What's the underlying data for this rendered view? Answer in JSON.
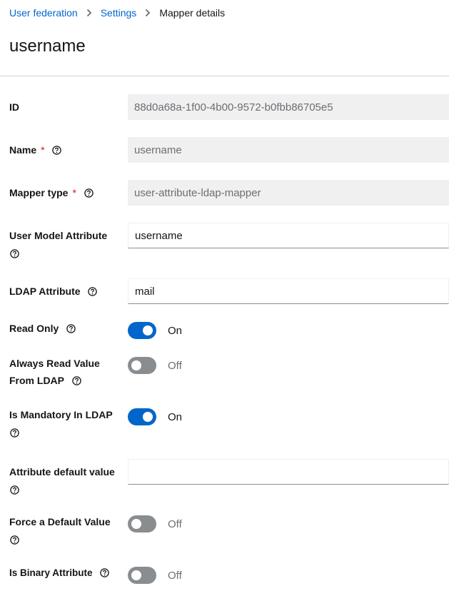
{
  "breadcrumb": {
    "items": [
      "User federation",
      "Settings"
    ],
    "current": "Mapper details"
  },
  "page": {
    "title": "username"
  },
  "fields": {
    "id": {
      "label": "ID",
      "value": "88d0a68a-1f00-4b00-9572-b0fbb86705e5"
    },
    "name": {
      "label": "Name",
      "required": "*",
      "value": "username"
    },
    "mapper_type": {
      "label": "Mapper type",
      "required": "*",
      "value": "user-attribute-ldap-mapper"
    },
    "user_model_attribute": {
      "label": "User Model Attribute",
      "value": "username"
    },
    "ldap_attribute": {
      "label": "LDAP Attribute",
      "value": "mail"
    },
    "read_only": {
      "label": "Read Only",
      "state": "On"
    },
    "always_read": {
      "label_line1": "Always Read Value",
      "label_line2": "From LDAP",
      "state": "Off"
    },
    "is_mandatory": {
      "label": "Is Mandatory In LDAP",
      "state": "On"
    },
    "attribute_default": {
      "label": "Attribute default value",
      "value": ""
    },
    "force_default": {
      "label": "Force a Default Value",
      "state": "Off"
    },
    "is_binary": {
      "label": "Is Binary Attribute",
      "state": "Off"
    }
  },
  "colors": {
    "link": "#0066cc",
    "toggle_on": "#0066cc",
    "toggle_off": "#8a8d90",
    "required": "#c9190b"
  }
}
